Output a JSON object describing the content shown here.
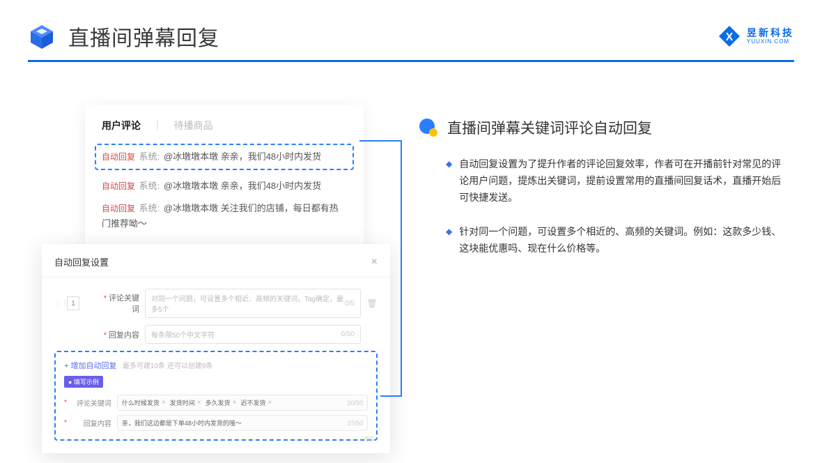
{
  "header": {
    "title": "直播间弹幕回复",
    "logo_main": "昱新科技",
    "logo_sub": "YUUXIN.COM"
  },
  "comments_card": {
    "tab_active": "用户评论",
    "tab_inactive": "待播商品",
    "highlighted": "自动回复 系统: @冰墩墩本墩 亲亲，我们48小时内发货",
    "highlighted_badge": "自动回复",
    "highlighted_sys": "系统:",
    "highlighted_text": "@冰墩墩本墩 亲亲，我们48小时内发货",
    "item2_badge": "自动回复",
    "item2_sys": "系统:",
    "item2_text": "@冰墩墩本墩 亲亲，我们48小时内发货",
    "item3_badge": "自动回复",
    "item3_sys": "系统:",
    "item3_text": "@冰墩墩本墩 关注我们的店铺，每日都有热门推荐呦～"
  },
  "settings": {
    "title": "自动回复设置",
    "row_num": "1",
    "kw_label": "评论关键词",
    "kw_placeholder": "对同一个问题，可设置多个相近、高频的关键词，Tag确定，最多5个",
    "kw_count": "0/5",
    "content_label": "回复内容",
    "content_placeholder": "每条限50个中文字符",
    "content_count": "0/50",
    "add_link": "+ 增加自动回复",
    "add_hint": "最多可建10条 还可以创建9条",
    "example_badge": "● 填写示例",
    "ex_kw_label": "评论关键词",
    "ex_tags": [
      "什么时候发货",
      "发货时间",
      "多久发货",
      "迟不发货"
    ],
    "ex_kw_count": "20/50",
    "ex_content_label": "回复内容",
    "ex_content_text": "亲，我们这边都是下单48小时内发货的哦～",
    "ex_content_count": "37/50",
    "outer_count": "/50"
  },
  "right": {
    "title": "直播间弹幕关键词评论自动回复",
    "bullet1": "自动回复设置为了提升作者的评论回复效率，作者可在开播前针对常见的评论用户问题，提炼出关键词，提前设置常用的直播间回复话术，直播开始后可快捷发送。",
    "bullet2": "针对同一个问题，可设置多个相近的、高频的关键词。例如：这款多少钱、这块能优惠吗、现在什么价格等。"
  }
}
